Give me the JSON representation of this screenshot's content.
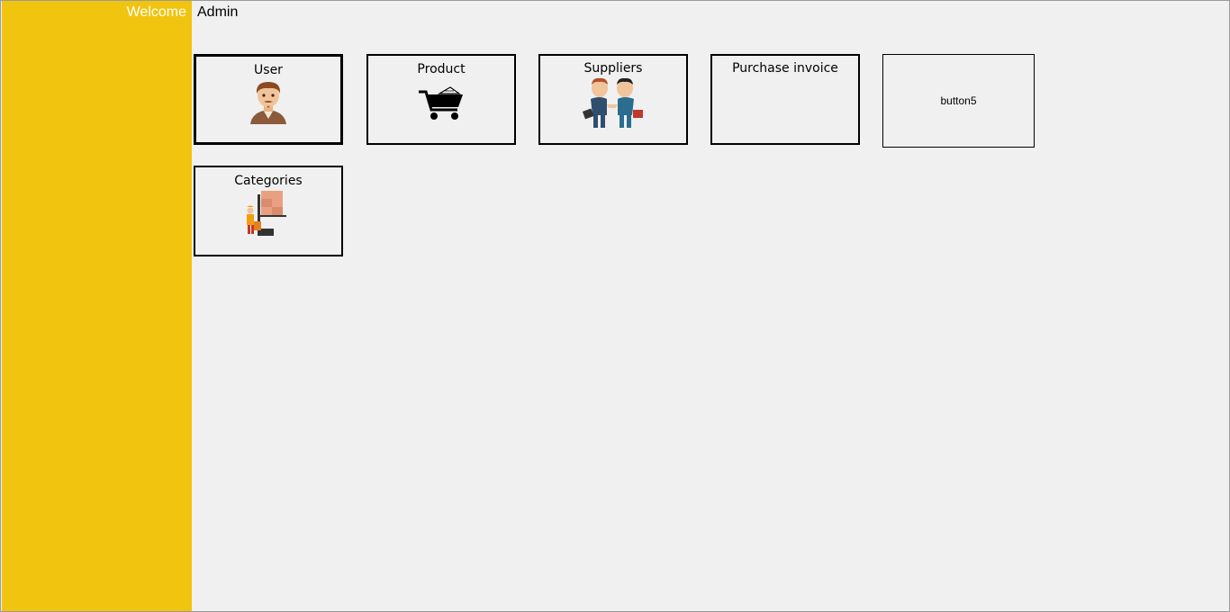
{
  "header": {
    "welcome_label": "Welcome",
    "username": "Admin"
  },
  "tiles": [
    {
      "label": "User",
      "icon": "user-avatar-icon"
    },
    {
      "label": "Product",
      "icon": "shopping-cart-icon"
    },
    {
      "label": "Suppliers",
      "icon": "handshake-people-icon"
    },
    {
      "label": "Purchase invoice",
      "icon": ""
    },
    {
      "label": "button5",
      "icon": ""
    },
    {
      "label": "Categories",
      "icon": "warehouse-forklift-icon"
    }
  ],
  "colors": {
    "sidebar": "#f1c40f",
    "background": "#f0f0f0",
    "welcome_text": "#ffffff"
  }
}
